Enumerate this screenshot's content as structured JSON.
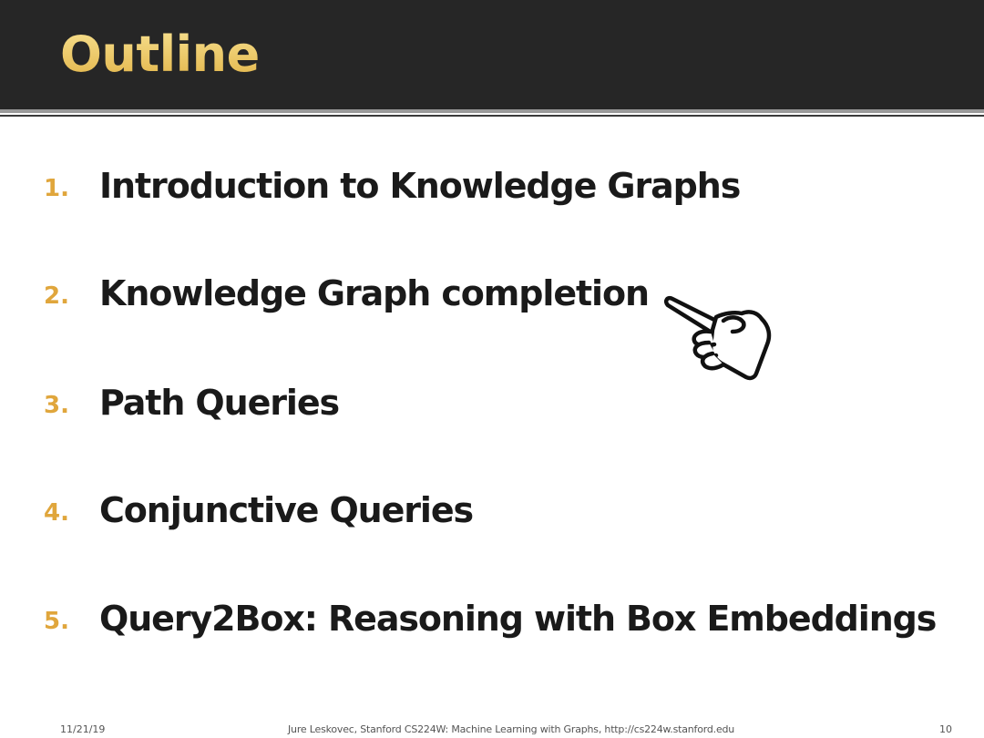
{
  "slide": {
    "title": "Outline",
    "items": [
      {
        "number": "1.",
        "text": "Introduction to Knowledge Graphs"
      },
      {
        "number": "2.",
        "text": "Knowledge Graph completion"
      },
      {
        "number": "3.",
        "text": "Path Queries"
      },
      {
        "number": "4.",
        "text": "Conjunctive Queries"
      },
      {
        "number": "5.",
        "text": "Query2Box: Reasoning with Box Embeddings"
      }
    ],
    "pointer_icon": "pointing-hand-icon",
    "footer": {
      "date": "11/21/19",
      "credit": "Jure Leskovec, Stanford CS224W: Machine Learning with Graphs, http://cs224w.stanford.edu",
      "page": "10"
    }
  },
  "colors": {
    "title_bar": "#262626",
    "title_text": "#e8c766",
    "number_accent": "#e0a63c",
    "body_text": "#1a1a1a"
  }
}
